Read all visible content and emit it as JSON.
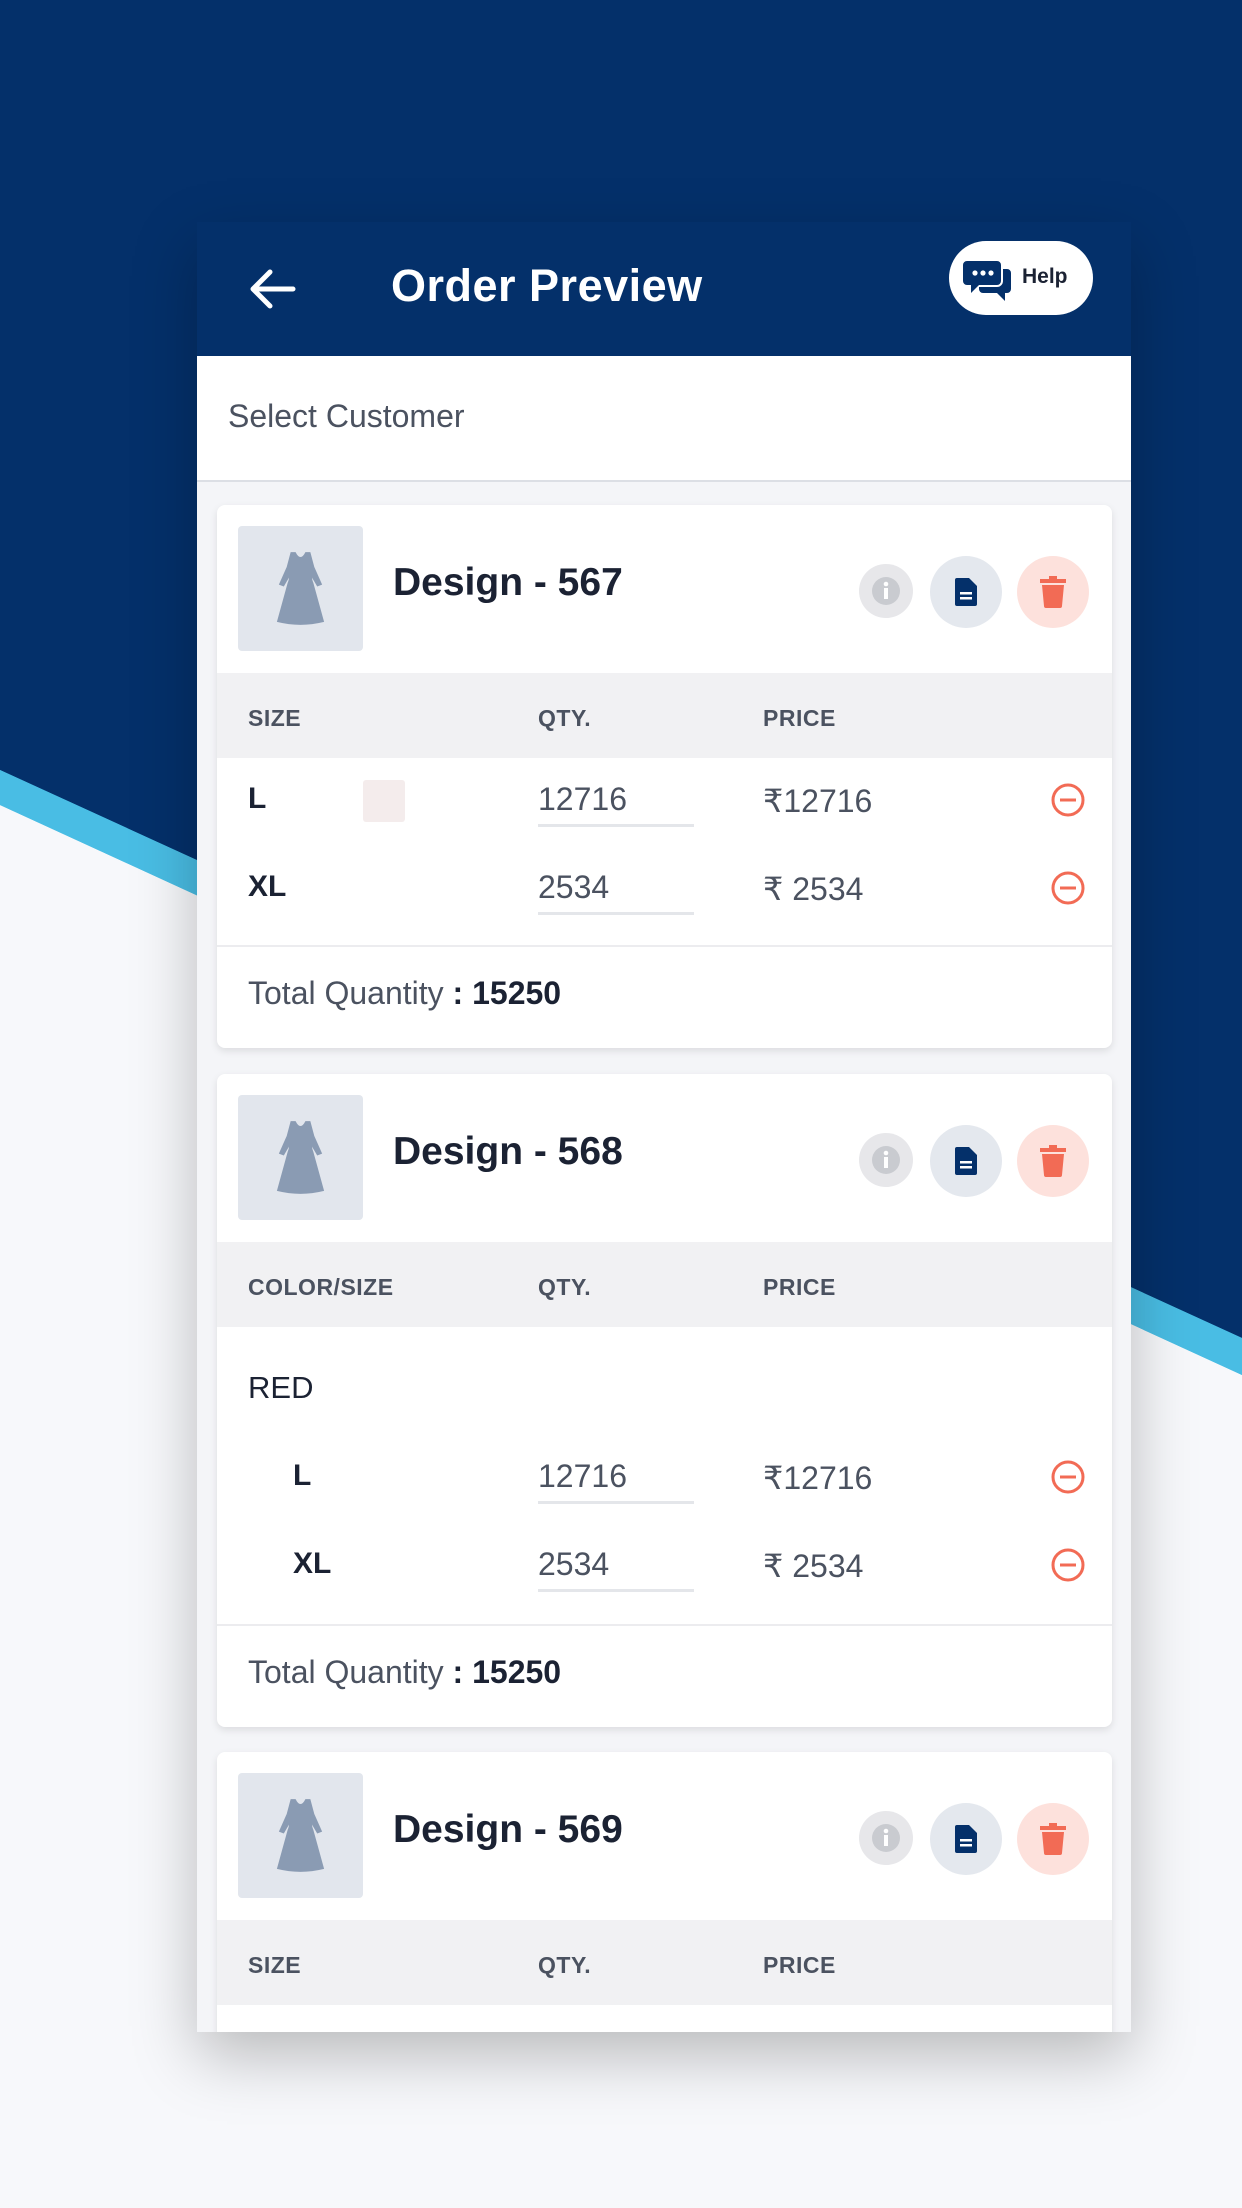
{
  "colors": {
    "navy": "#04306a",
    "accent_blue": "#49bde4",
    "delete_red": "#f26b55",
    "icon_grey": "#9aa3b2"
  },
  "header": {
    "back_icon": "arrow-left-icon",
    "title": "Order Preview",
    "help_label": "Help",
    "help_icon": "chat-bubbles-icon"
  },
  "customer": {
    "placeholder": "Select Customer"
  },
  "cards": [
    {
      "design": "Design - 567",
      "headers": [
        "SIZE",
        "QTY.",
        "PRICE"
      ],
      "rows": [
        {
          "size": "L",
          "qty": "12716",
          "price": "₹12716"
        },
        {
          "size": "XL",
          "qty": "2534",
          "price": "₹ 2534"
        }
      ],
      "total_label": "Total Quantity",
      "total_value": ": 15250"
    },
    {
      "design": "Design - 568",
      "headers": [
        "COLOR/SIZE",
        "QTY.",
        "PRICE"
      ],
      "color": "RED",
      "rows": [
        {
          "size": "L",
          "qty": "12716",
          "price": "₹12716"
        },
        {
          "size": "XL",
          "qty": "2534",
          "price": "₹ 2534"
        }
      ],
      "total_label": "Total Quantity",
      "total_value": ": 15250"
    },
    {
      "design": "Design - 569",
      "headers": [
        "SIZE",
        "QTY.",
        "PRICE"
      ]
    }
  ],
  "icons": {
    "info": "info-icon",
    "doc": "document-icon",
    "delete": "trash-icon",
    "remove": "minus-circle-icon",
    "thumb": "dress-icon"
  }
}
